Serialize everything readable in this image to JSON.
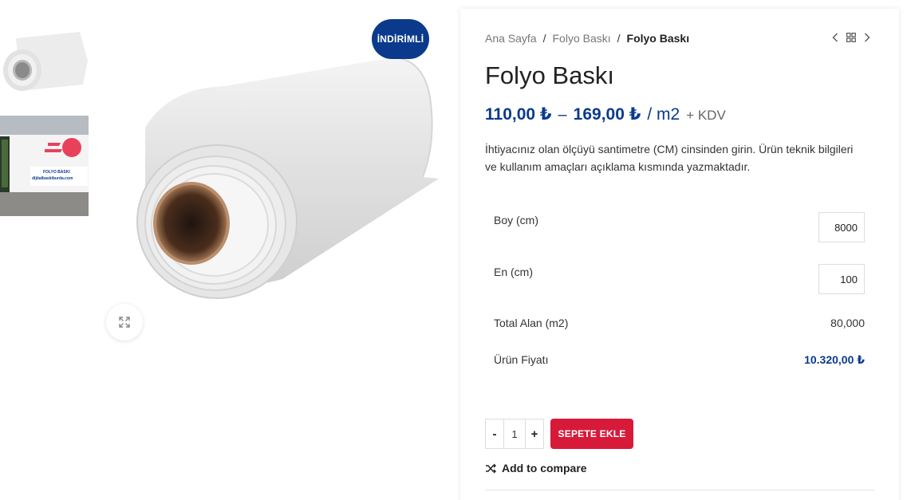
{
  "badge": {
    "label": "İNDİRİMLİ"
  },
  "thumbnails": [
    {
      "name": "white-roll-thumbnail"
    },
    {
      "name": "storefront-thumbnail",
      "sign_line1": "FOLYO BASKI",
      "sign_line2": "dijitalbaskiburda.com"
    }
  ],
  "breadcrumb": {
    "items": [
      "Ana Sayfa",
      "Folyo Baskı"
    ],
    "current": "Folyo Baskı",
    "separator": "/"
  },
  "product": {
    "title": "Folyo Baskı",
    "price_min": "110,00 ₺",
    "price_dash": "–",
    "price_max": "169,00 ₺",
    "price_unit": "/ m2",
    "tax_note": "+ KDV",
    "description": "İhtiyacınız olan ölçüyü santimetre (CM) cinsinden girin. Ürün teknik bilgileri ve kullanım amaçları açıklama kısmında yazmaktadır."
  },
  "calculator": {
    "boy_label": "Boy (cm)",
    "boy_value": "8000",
    "en_label": "En (cm)",
    "en_value": "100",
    "total_label": "Total Alan (m2)",
    "total_value": "80,000",
    "fiyat_label": "Ürün Fiyatı",
    "fiyat_value": "10.320,00 ₺"
  },
  "cart": {
    "minus": "-",
    "quantity": "1",
    "plus": "+",
    "add_label": "SEPETE EKLE"
  },
  "compare": {
    "label": "Add to compare"
  },
  "colors": {
    "brand_blue": "#0b3a8c",
    "cart_red": "#d71a3a"
  }
}
